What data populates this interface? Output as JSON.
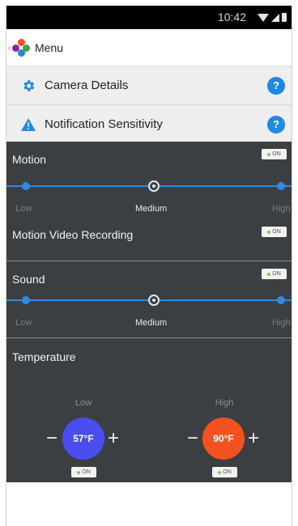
{
  "status_bar": {
    "time": "10:42"
  },
  "menu": {
    "label": "Menu"
  },
  "rows": [
    {
      "label": "Camera Details",
      "help": "?"
    },
    {
      "label": "Notification Sensitivity",
      "help": "?"
    }
  ],
  "motion": {
    "title": "Motion",
    "toggle": "ON",
    "levels": {
      "low": "Low",
      "medium": "Medium",
      "high": "High"
    },
    "selected_level": "Medium"
  },
  "motion_video_recording": {
    "title": "Motion Video Recording",
    "toggle": "ON"
  },
  "sound": {
    "title": "Sound",
    "toggle": "ON",
    "levels": {
      "low": "Low",
      "medium": "Medium",
      "high": "High"
    },
    "selected_level": "Medium"
  },
  "temperature": {
    "title": "Temperature",
    "low": {
      "label": "Low",
      "value": "57°F",
      "toggle": "ON",
      "color": "#4a4ef0"
    },
    "high": {
      "label": "High",
      "value": "90°F",
      "toggle": "ON",
      "color": "#f4511e"
    }
  },
  "colors": {
    "accent": "#2e8be0",
    "panel": "#3c3f41",
    "help": "#1e88e5"
  }
}
